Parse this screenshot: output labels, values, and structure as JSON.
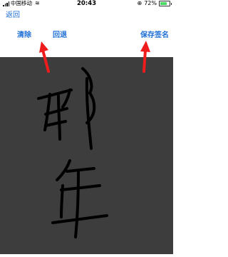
{
  "status_bar": {
    "carrier": "中国移动",
    "time": "20:43",
    "battery": "72%",
    "battery_level": 0.72
  },
  "nav": {
    "back_label": "返回"
  },
  "toolbar": {
    "clear_label": "清除",
    "undo_label": "回退",
    "save_label": "保存签名"
  },
  "colors": {
    "accent": "#1e6fd6",
    "canvas": "#3d3d3d",
    "annotation_arrow": "#ee1c1c",
    "ink": "#000000"
  }
}
